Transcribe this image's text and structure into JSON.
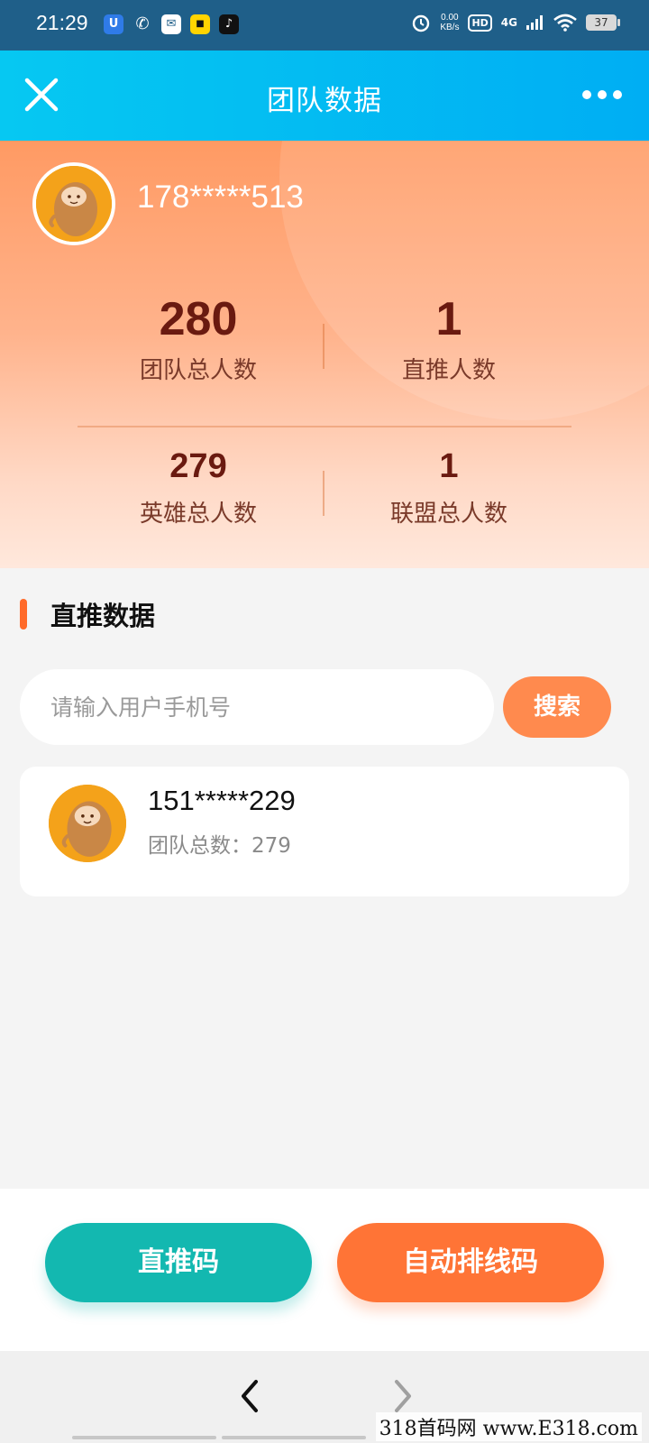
{
  "status_bar": {
    "time": "21:29",
    "net_speed_value": "0.00",
    "net_speed_unit": "KB/s",
    "hd_label": "HD",
    "network_type": "4G",
    "battery": "37"
  },
  "navbar": {
    "title": "团队数据"
  },
  "profile": {
    "phone": "178*****513"
  },
  "stats": [
    {
      "value": "280",
      "label": "团队总人数"
    },
    {
      "value": "1",
      "label": "直推人数"
    },
    {
      "value": "279",
      "label": "英雄总人数"
    },
    {
      "value": "1",
      "label": "联盟总人数"
    }
  ],
  "section": {
    "title": "直推数据"
  },
  "search": {
    "placeholder": "请输入用户手机号",
    "button_label": "搜索"
  },
  "members": [
    {
      "phone": "151*****229",
      "team_total": "团队总数：279"
    }
  ],
  "actions": {
    "direct_code": "直推码",
    "auto_code": "自动排线码"
  },
  "watermark": "318首码网 www.E318.com",
  "colors": {
    "nav_gradient_start": "#06c8f2",
    "nav_gradient_end": "#00aef3",
    "hero_orange": "#ff9a63",
    "accent_orange": "#ff7436",
    "accent_teal": "#13b8b0",
    "stat_number": "#6a1a10"
  }
}
